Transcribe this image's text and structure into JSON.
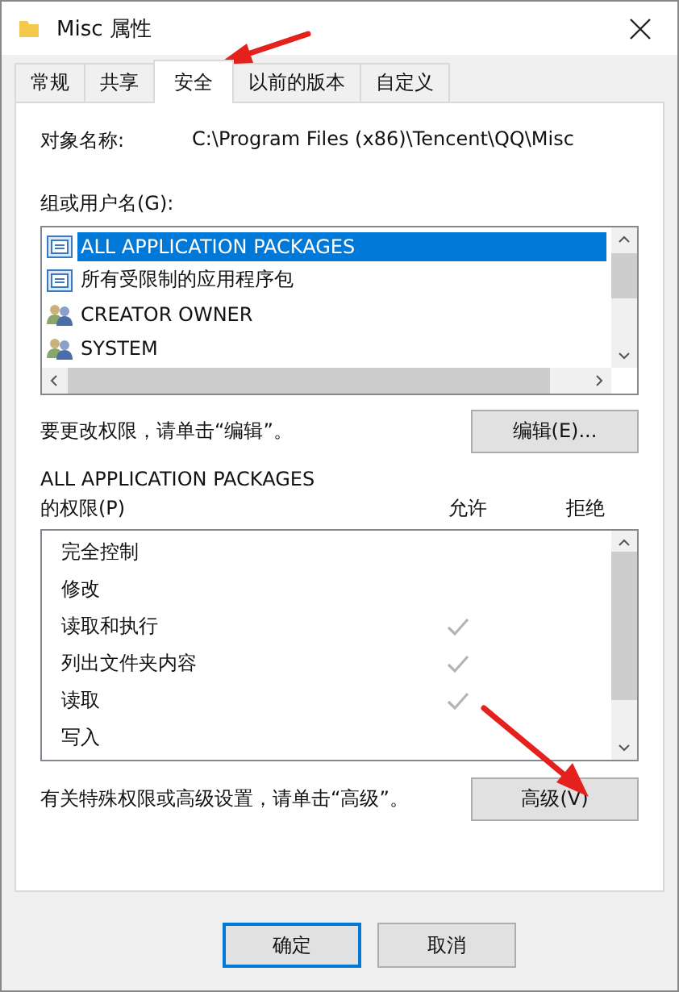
{
  "window": {
    "title": "Misc 属性"
  },
  "tabs": [
    {
      "label": "常规",
      "selected": false
    },
    {
      "label": "共享",
      "selected": false
    },
    {
      "label": "安全",
      "selected": true
    },
    {
      "label": "以前的版本",
      "selected": false
    },
    {
      "label": "自定义",
      "selected": false
    }
  ],
  "object_name": {
    "label": "对象名称:",
    "value": "C:\\Program Files (x86)\\Tencent\\QQ\\Misc"
  },
  "principals": {
    "label": "组或用户名(G):",
    "items": [
      {
        "name": "ALL APPLICATION PACKAGES",
        "kind": "package",
        "selected": true
      },
      {
        "name": "所有受限制的应用程序包",
        "kind": "package",
        "selected": false
      },
      {
        "name": "CREATOR OWNER",
        "kind": "user",
        "selected": false
      },
      {
        "name": "SYSTEM",
        "kind": "user",
        "selected": false
      }
    ]
  },
  "edit_hint": "要更改权限，请单击“编辑”。",
  "edit_button": "编辑(E)...",
  "permissions": {
    "subject": "ALL APPLICATION PACKAGES",
    "label": "的权限(P)",
    "allow_heading": "允许",
    "deny_heading": "拒绝",
    "rows": [
      {
        "name": "完全控制",
        "allow": false
      },
      {
        "name": "修改",
        "allow": false
      },
      {
        "name": "读取和执行",
        "allow": true
      },
      {
        "name": "列出文件夹内容",
        "allow": true
      },
      {
        "name": "读取",
        "allow": true
      },
      {
        "name": "写入",
        "allow": false
      }
    ]
  },
  "advanced_hint": "有关特殊权限或高级设置，请单击“高级”。",
  "advanced_button": "高级(V)",
  "buttons": [
    {
      "label": "确定",
      "kind": "default"
    },
    {
      "label": "取消",
      "kind": "normal"
    }
  ]
}
